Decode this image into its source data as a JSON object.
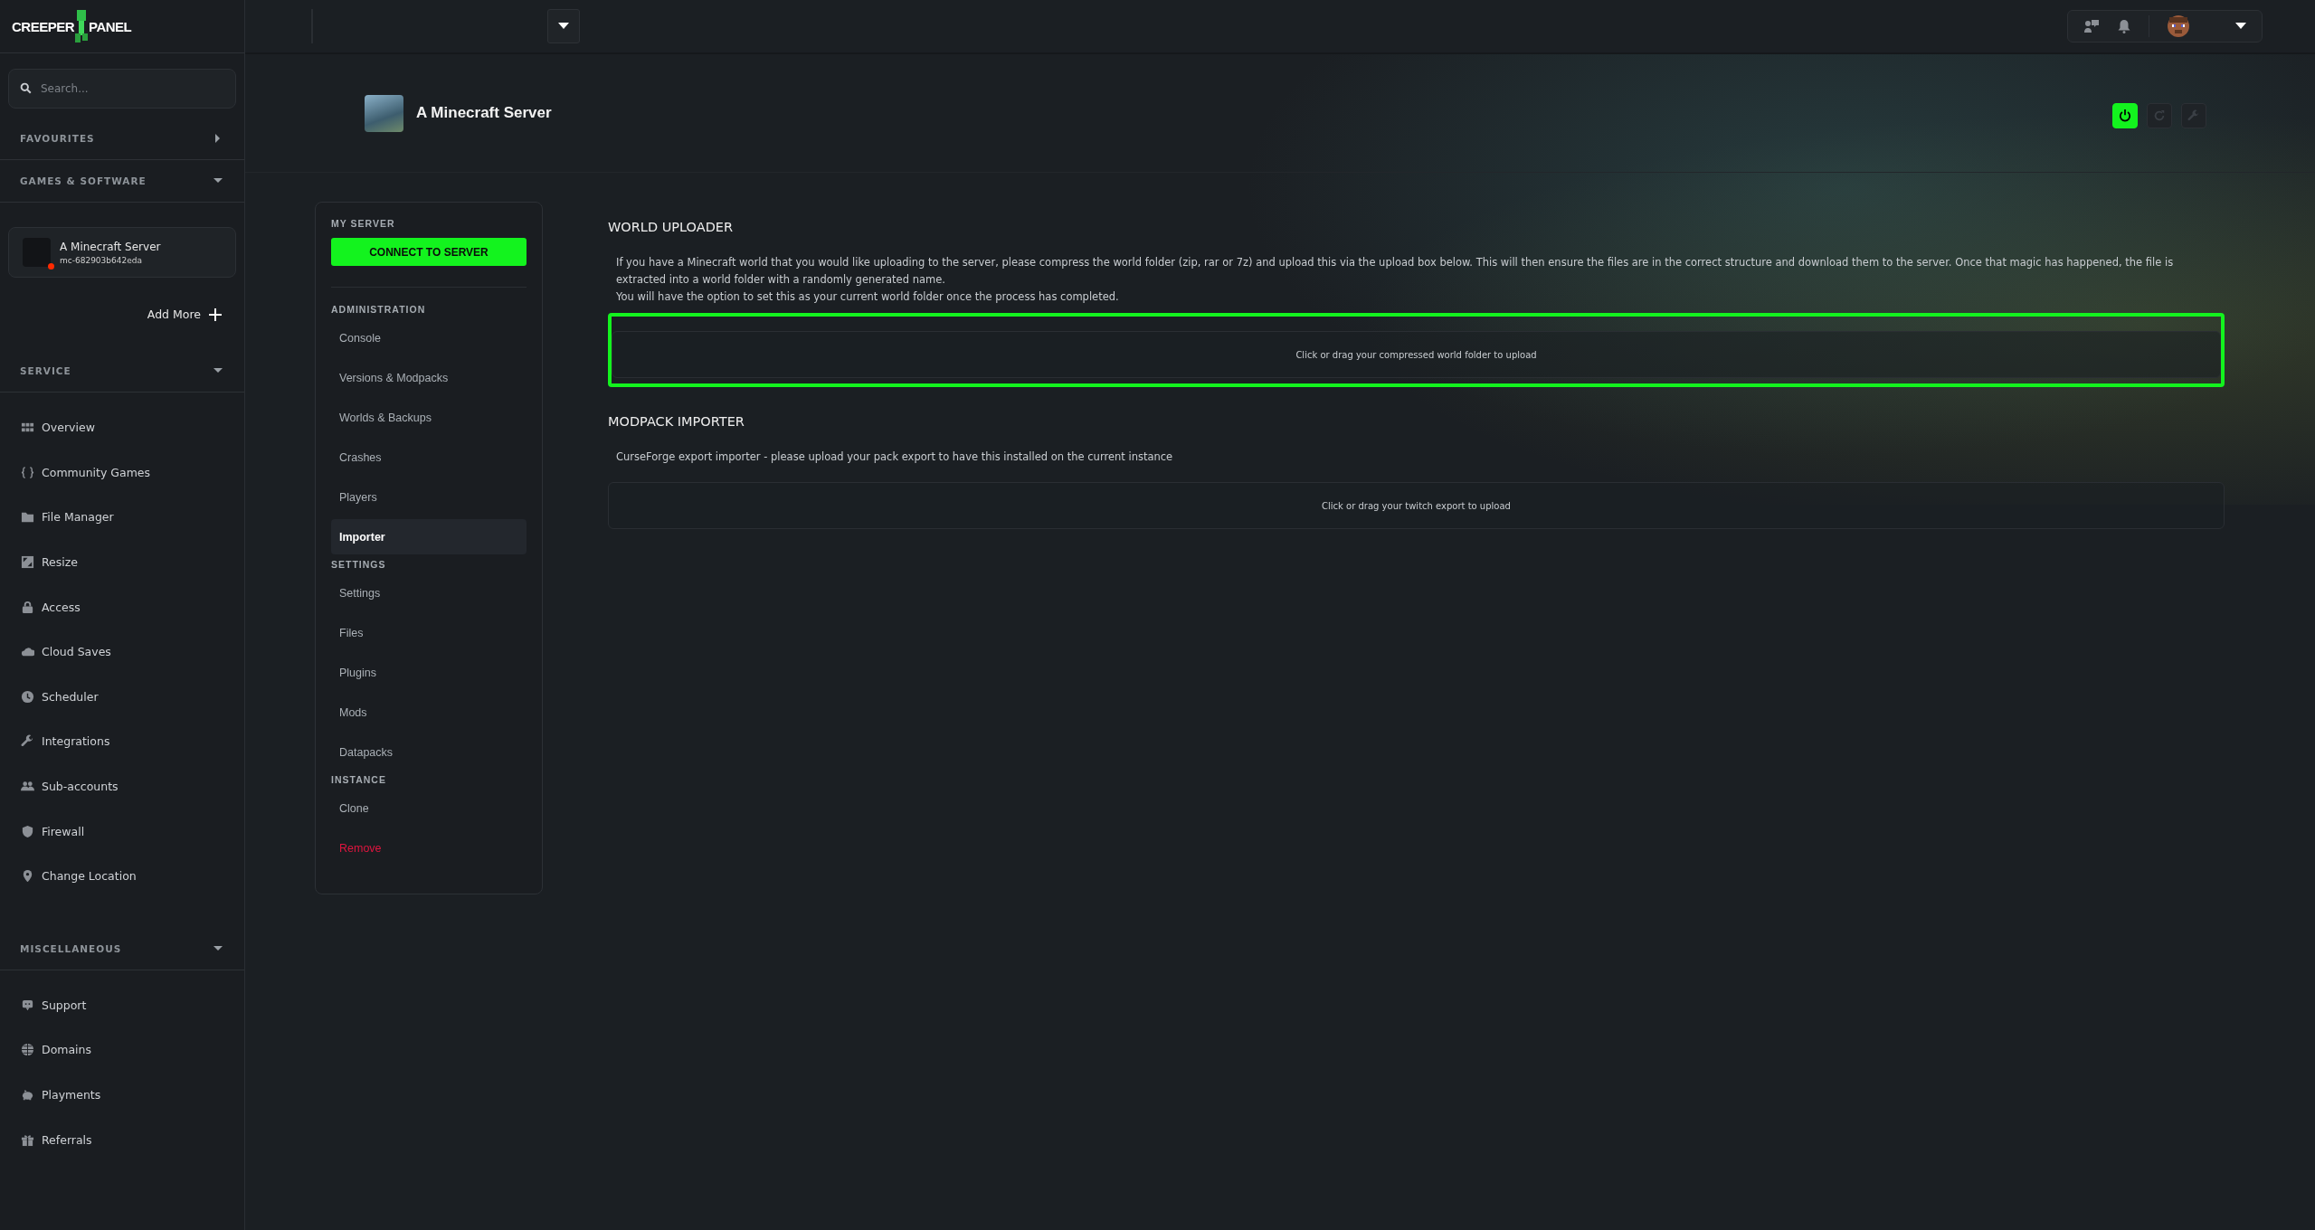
{
  "logo": {
    "left": "CREEPER",
    "right": "PANEL"
  },
  "search": {
    "placeholder": "Search..."
  },
  "sidebar_sections": [
    {
      "title": "FAVOURITES",
      "expanded": false
    },
    {
      "title": "GAMES & SOFTWARE",
      "expanded": true
    }
  ],
  "server_card": {
    "name": "A Minecraft Server",
    "id": "mc-682903b642eda",
    "online": false
  },
  "add_more": "Add More",
  "nav_groups": [
    {
      "title": "SERVICE",
      "expanded": true,
      "items": [
        {
          "label": "Overview"
        },
        {
          "label": "Community Games"
        },
        {
          "label": "File Manager"
        },
        {
          "label": "Resize"
        },
        {
          "label": "Access"
        },
        {
          "label": "Cloud Saves"
        },
        {
          "label": "Scheduler"
        },
        {
          "label": "Integrations"
        },
        {
          "label": "Sub-accounts"
        },
        {
          "label": "Firewall"
        },
        {
          "label": "Change Location"
        }
      ]
    },
    {
      "title": "MISCELLANEOUS",
      "expanded": true,
      "items": [
        {
          "label": "Support"
        },
        {
          "label": "Domains"
        },
        {
          "label": "Playments"
        },
        {
          "label": "Referrals"
        }
      ]
    }
  ],
  "header": {
    "title": "A Minecraft Server",
    "power_on": true
  },
  "server_menu": {
    "title": "MY SERVER",
    "connect_button": "CONNECT TO SERVER",
    "groups": [
      {
        "title": "ADMINISTRATION",
        "items": [
          {
            "label": "Console",
            "selected": false,
            "danger": false
          },
          {
            "label": "Versions & Modpacks",
            "selected": false,
            "danger": false
          },
          {
            "label": "Worlds & Backups",
            "selected": false,
            "danger": false
          },
          {
            "label": "Crashes",
            "selected": false,
            "danger": false
          },
          {
            "label": "Players",
            "selected": false,
            "danger": false
          },
          {
            "label": "Importer",
            "selected": true,
            "danger": false
          }
        ]
      },
      {
        "title": "SETTINGS",
        "items": [
          {
            "label": "Settings",
            "selected": false,
            "danger": false
          },
          {
            "label": "Files",
            "selected": false,
            "danger": false
          },
          {
            "label": "Plugins",
            "selected": false,
            "danger": false
          },
          {
            "label": "Mods",
            "selected": false,
            "danger": false
          },
          {
            "label": "Datapacks",
            "selected": false,
            "danger": false
          }
        ]
      },
      {
        "title": "INSTANCE",
        "items": [
          {
            "label": "Clone",
            "selected": false,
            "danger": false
          },
          {
            "label": "Remove",
            "selected": false,
            "danger": true
          }
        ]
      }
    ]
  },
  "sections": [
    {
      "title": "WORLD UPLOADER",
      "paragraphs": [
        "If you have a Minecraft world that you would like uploading to the server, please compress the world folder (zip, rar or 7z) and upload this via the upload box below. This will then ensure the files are in the correct structure and download them to the server. Once that magic has happened, the file is extracted into a world folder with a randomly generated name.",
        "You will have the option to set this as your current world folder once the process has completed."
      ],
      "dropzone": "Click or drag your compressed world folder to upload",
      "drag_active": true
    },
    {
      "title": "MODPACK IMPORTER",
      "paragraphs": [
        "CurseForge export importer - please upload your pack export to have this installed on the current instance"
      ],
      "dropzone": "Click or drag your twitch export to upload",
      "drag_active": false
    }
  ]
}
